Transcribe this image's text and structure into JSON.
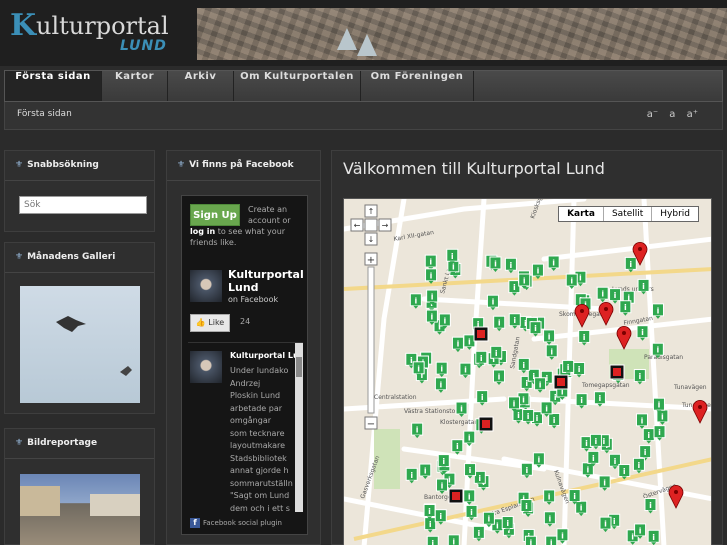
{
  "header": {
    "logo_k": "K",
    "logo_rest": "ulturportal",
    "logo_sub": "LUND"
  },
  "nav": {
    "items": [
      {
        "label": "Första sidan",
        "active": true
      },
      {
        "label": "Kartor"
      },
      {
        "label": "Arkiv"
      },
      {
        "label": "Om Kulturportalen"
      },
      {
        "label": "Om Föreningen"
      }
    ]
  },
  "breadcrumb": "Första sidan",
  "font_size_controls": "a⁻ a a⁺",
  "sidebar": {
    "search": {
      "title": "Snabbsökning",
      "placeholder": "Sök"
    },
    "gallery": {
      "title": "Månadens Galleri"
    },
    "report": {
      "title": "Bildreportage"
    }
  },
  "facebook": {
    "title": "Vi finns på Facebook",
    "signup_label": "Sign Up",
    "create_text": "Create an account or",
    "login_link": "log in",
    "login_text": "to see what your friends like.",
    "page_name": "Kulturportal Lund",
    "on_facebook": "on Facebook",
    "like_label": "Like",
    "like_count": "24",
    "post_title": "Kulturportal Lu",
    "post_text": "Under lundako Andrzej Ploskin Lund arbetade par omgångar som tecknare layoutmakare Stadsbibliotek annat gjorde h sommarutställn \"Sagt om Lund dem och i ett s akvareller kom",
    "plugin_label": "Facebook social plugin"
  },
  "main": {
    "title": "Välkommen till Kulturportal Lund",
    "map_types": [
      "Karta",
      "Satellit",
      "Hybrid"
    ],
    "map_selected": "Karta"
  },
  "map_labels": [
    "Karl XII-gatan",
    "Kiosksgatan",
    "Lunds univers",
    "Finngatan",
    "Tomegapsgatan",
    "Paradisgatan",
    "Sandgatan",
    "Bantorget",
    "Gasverksgatan",
    "Klostergatan",
    "Kulnavägen",
    "Tunavägen",
    "Östervägen",
    "Centralstation",
    "Västra Stationstorget",
    "Tunavägen",
    "Skomakaregatan",
    "Sankt Laurentii",
    "Södra Esplanaden"
  ],
  "colors": {
    "accent": "#3b8fb7",
    "marker_green": "#2fa84f",
    "marker_red": "#d22",
    "map_bg": "#ece6da"
  }
}
